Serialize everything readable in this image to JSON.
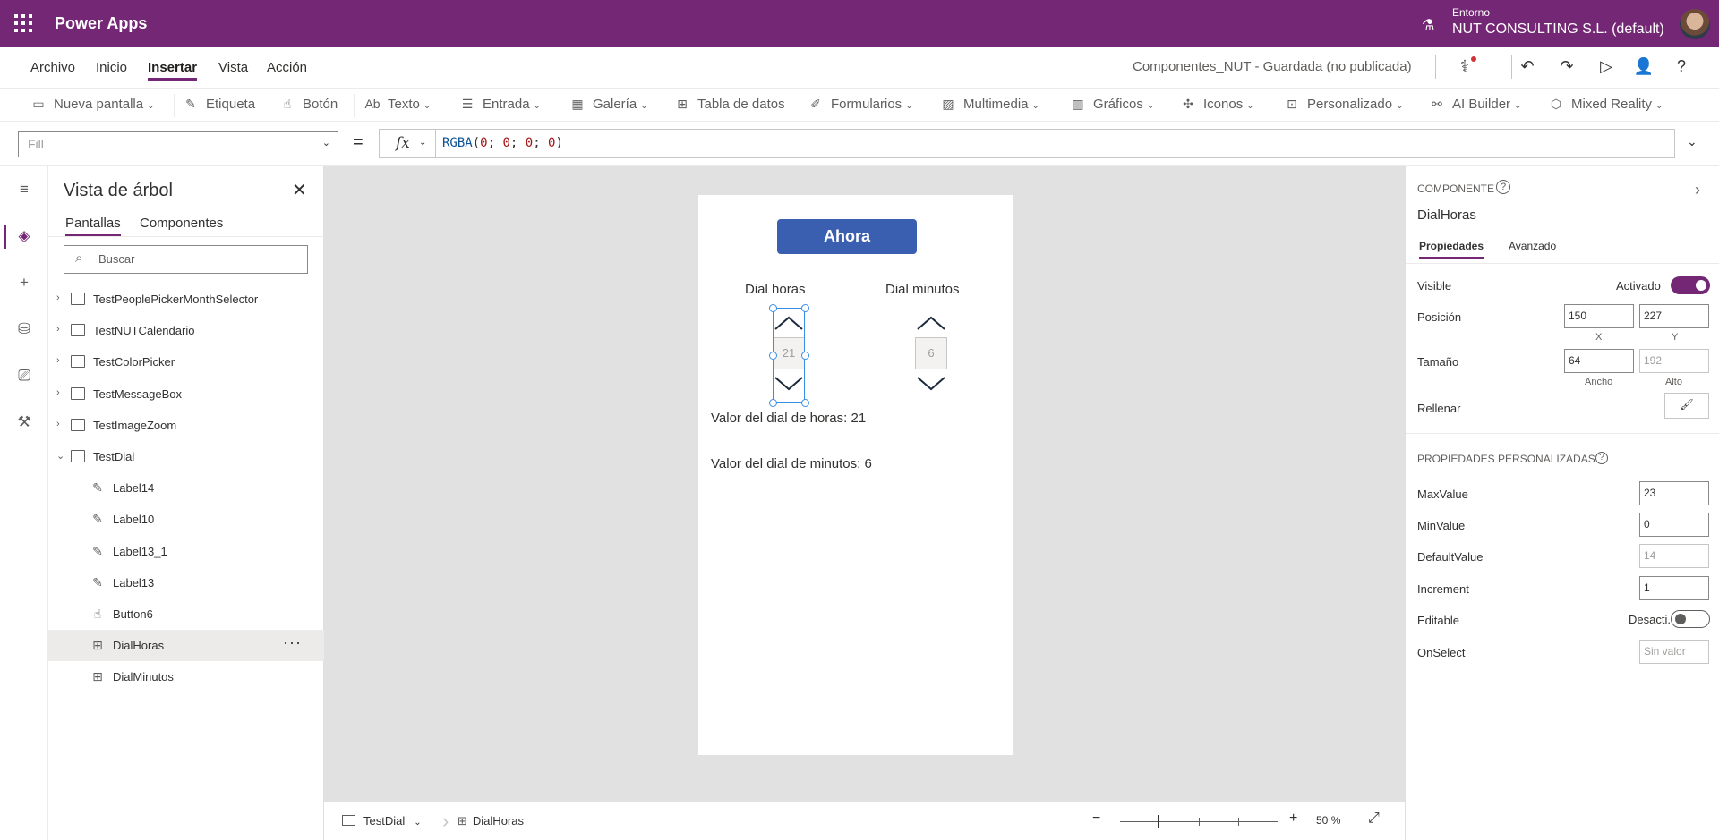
{
  "app": {
    "name": "Power Apps",
    "env_label": "Entorno",
    "env_name": "NUT CONSULTING S.L. (default)"
  },
  "menu": {
    "items": [
      "Archivo",
      "Inicio",
      "Insertar",
      "Vista",
      "Acción"
    ],
    "active": "Insertar",
    "doc_title": "Componentes_NUT - Guardada (no publicada)"
  },
  "ribbon": {
    "items": [
      {
        "label": "Nueva pantalla",
        "icon": "new-screen-icon"
      },
      {
        "label": "Etiqueta",
        "icon": "label-icon"
      },
      {
        "label": "Botón",
        "icon": "button-icon"
      },
      {
        "label": "Texto",
        "icon": "text-icon"
      },
      {
        "label": "Entrada",
        "icon": "input-icon"
      },
      {
        "label": "Galería",
        "icon": "gallery-icon"
      },
      {
        "label": "Tabla de datos",
        "icon": "data-table-icon"
      },
      {
        "label": "Formularios",
        "icon": "forms-icon"
      },
      {
        "label": "Multimedia",
        "icon": "media-icon"
      },
      {
        "label": "Gráficos",
        "icon": "charts-icon"
      },
      {
        "label": "Iconos",
        "icon": "icons-icon"
      },
      {
        "label": "Personalizado",
        "icon": "custom-icon"
      },
      {
        "label": "AI Builder",
        "icon": "ai-builder-icon"
      },
      {
        "label": "Mixed Reality",
        "icon": "mixed-reality-icon"
      }
    ]
  },
  "formula": {
    "property": "Fill",
    "eq": "=",
    "fx": "fx",
    "func": "RGBA",
    "open": "(",
    "a": "0",
    "b": "0",
    "c": "0",
    "d": "0",
    "sep": "; ",
    "close": ")"
  },
  "tree": {
    "title": "Vista de árbol",
    "tabs": [
      "Pantallas",
      "Componentes"
    ],
    "search_placeholder": "Buscar",
    "items": [
      {
        "label": "TestPeoplePickerMonthSelector",
        "kind": "screen",
        "indent": 0
      },
      {
        "label": "TestNUTCalendario",
        "kind": "screen",
        "indent": 0
      },
      {
        "label": "TestColorPicker",
        "kind": "screen",
        "indent": 0
      },
      {
        "label": "TestMessageBox",
        "kind": "screen",
        "indent": 0
      },
      {
        "label": "TestImageZoom",
        "kind": "screen",
        "indent": 0
      },
      {
        "label": "TestDial",
        "kind": "screen-open",
        "indent": 0
      },
      {
        "label": "Label14",
        "kind": "label",
        "indent": 1
      },
      {
        "label": "Label10",
        "kind": "label",
        "indent": 1
      },
      {
        "label": "Label13_1",
        "kind": "label",
        "indent": 1
      },
      {
        "label": "Label13",
        "kind": "label",
        "indent": 1
      },
      {
        "label": "Button6",
        "kind": "button",
        "indent": 1
      },
      {
        "label": "DialHoras",
        "kind": "component",
        "indent": 1,
        "selected": true
      },
      {
        "label": "DialMinutos",
        "kind": "component",
        "indent": 1
      }
    ]
  },
  "canvas": {
    "button": "Ahora",
    "dial_hours_title": "Dial horas",
    "dial_minutes_title": "Dial minutos",
    "dial_hours_value": "21",
    "dial_minutes_value": "6",
    "hours_label": "Valor del dial de horas: 21",
    "minutes_label": "Valor del dial de minutos: 6"
  },
  "status": {
    "screen": "TestDial",
    "component": "DialHoras",
    "zoom": "50",
    "zoom_unit": "%"
  },
  "props": {
    "section": "COMPONENTE",
    "name": "DialHoras",
    "tabs": [
      "Propiedades",
      "Avanzado"
    ],
    "visible_label": "Visible",
    "visible_value": "Activado",
    "pos_label": "Posición",
    "x": "150",
    "y": "227",
    "x_sub": "X",
    "y_sub": "Y",
    "size_label": "Tamaño",
    "w": "64",
    "h": "192",
    "w_sub": "Ancho",
    "h_sub": "Alto",
    "fill_label": "Rellenar",
    "custom_section": "PROPIEDADES PERSONALIZADAS",
    "custom": [
      {
        "label": "MaxValue",
        "value": "23"
      },
      {
        "label": "MinValue",
        "value": "0"
      },
      {
        "label": "DefaultValue",
        "value": "14"
      },
      {
        "label": "Increment",
        "value": "1"
      }
    ],
    "editable_label": "Editable",
    "editable_value": "Desacti...",
    "onselect_label": "OnSelect",
    "onselect_placeholder": "Sin valor"
  }
}
